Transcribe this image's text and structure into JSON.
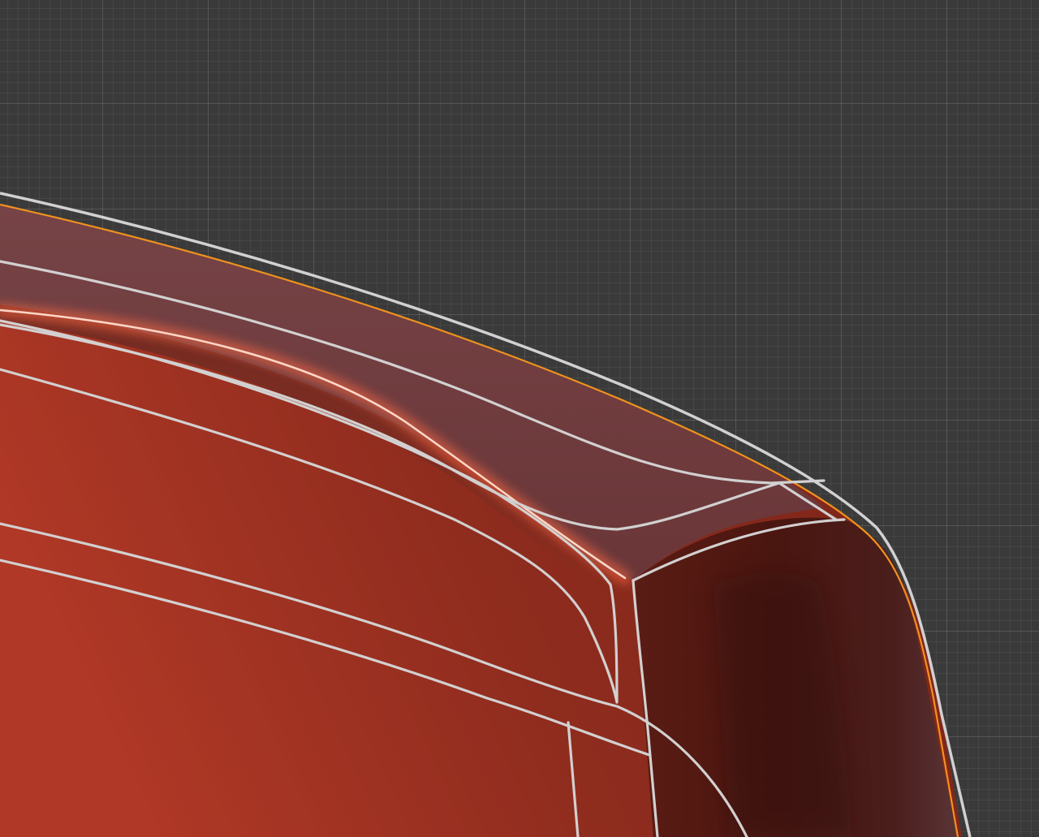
{
  "viewport": {
    "background_color": "#3a3a3a",
    "grid": {
      "minor_line_color": "#454545",
      "major_line_color": "#4b4b4b"
    }
  },
  "model": {
    "surface_color": "#8e2c1e",
    "bevel_color": "#6e3a3c",
    "dark_side_color": "#4a1812",
    "highlight_color": "#ff7a55",
    "selection_outline_color": "#f0921e",
    "wire_color": "#d2d0d0"
  }
}
